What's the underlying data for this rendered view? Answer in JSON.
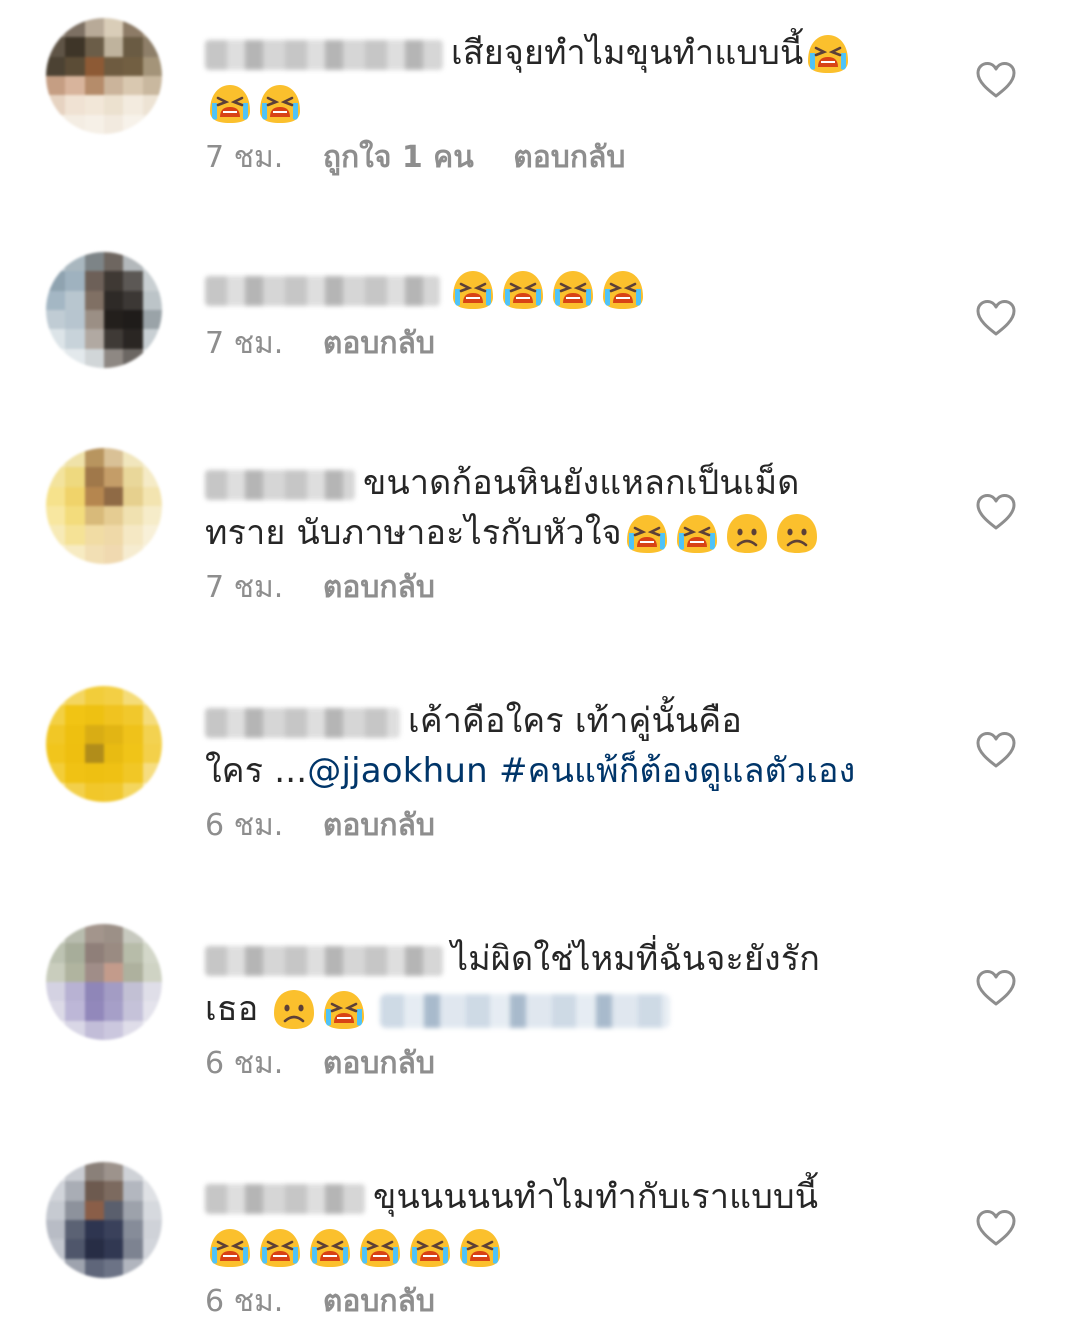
{
  "comments": [
    {
      "text": "เสียจุยทำไมขุนทำแบบนี้",
      "time": "7 ชม.",
      "likes": "ถูกใจ 1 คน",
      "reply": "ตอบกลับ",
      "emojis": [
        "loudly-crying-face-emoji",
        "loudly-crying-face-emoji",
        "loudly-crying-face-emoji"
      ]
    },
    {
      "text": "",
      "time": "7 ชม.",
      "reply": "ตอบกลับ",
      "emojis": [
        "loudly-crying-face-emoji",
        "loudly-crying-face-emoji",
        "loudly-crying-face-emoji",
        "loudly-crying-face-emoji"
      ]
    },
    {
      "text_line1": "ขนาดก้อนหินยังแหลกเป็นเม็ด",
      "text_line2": "ทราย นับภาษาอะไรกับหัวใจ",
      "time": "7 ชม.",
      "reply": "ตอบกลับ",
      "emojis": [
        "loudly-crying-face-emoji",
        "loudly-crying-face-emoji",
        "frowning-face-emoji",
        "frowning-face-emoji"
      ]
    },
    {
      "text_line1": "เค้าคือใคร เท้าคู่นั้นคือ",
      "text_line2": "ใคร ...",
      "mention": "@jjaokhun",
      "hashtag": "#คนแพ้ก็ต้องดูแลตัวเอง",
      "time": "6 ชม.",
      "reply": "ตอบกลับ"
    },
    {
      "text_line1": "ไม่ผิดใช่ไหมที่ฉันจะยังรัก",
      "text_line2": "เธอ",
      "time": "6 ชม.",
      "reply": "ตอบกลับ",
      "emojis": [
        "frowning-face-emoji",
        "loudly-crying-face-emoji"
      ]
    },
    {
      "text_line1": "ขุนนนนนทำไมทำกับเราแบบนี้",
      "time": "6 ชม.",
      "reply": "ตอบกลับ",
      "emojis": [
        "loudly-crying-face-emoji",
        "loudly-crying-face-emoji",
        "loudly-crying-face-emoji",
        "loudly-crying-face-emoji",
        "loudly-crying-face-emoji",
        "loudly-crying-face-emoji"
      ]
    }
  ],
  "colors": {
    "text": "#262626",
    "meta": "#8e8e8e",
    "link": "#003569",
    "emoji_face": "#fbc02d"
  },
  "icons": {
    "like": "heart-outline-icon"
  }
}
